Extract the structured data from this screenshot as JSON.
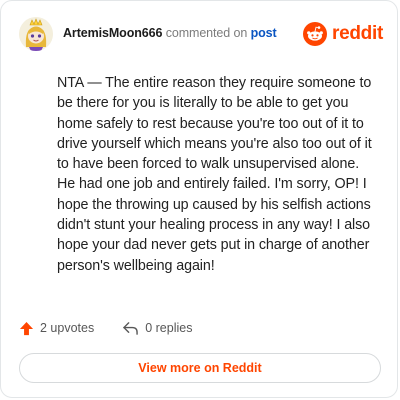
{
  "header": {
    "username": "ArtemisMoon666",
    "verb": "commented on",
    "post_link": "post",
    "avatar_icon": "snoo-avatar-icon",
    "brand_icon": "reddit-logo-icon",
    "brand_word": "reddit"
  },
  "comment": {
    "text": "NTA — The entire reason they require someone to be there for you is literally to be able to get you home safely to rest because you're too out of it to drive yourself which means you're also too out of it to have been forced to walk unsupervised alone. He had one job and entirely failed. I'm sorry, OP! I hope the throwing up caused by his selfish actions didn't stunt your healing process in any way! I also hope your dad never gets put in charge of another person's wellbeing again!"
  },
  "footer": {
    "upvotes_label": "2 upvotes",
    "upvote_icon": "upvote-arrow-icon",
    "replies_label": "0 replies",
    "reply_icon": "reply-arrow-icon"
  },
  "cta": {
    "label": "View more on Reddit"
  },
  "colors": {
    "brand": "#ff4500",
    "link": "#0a55c2",
    "muted": "#7c7c7c"
  }
}
